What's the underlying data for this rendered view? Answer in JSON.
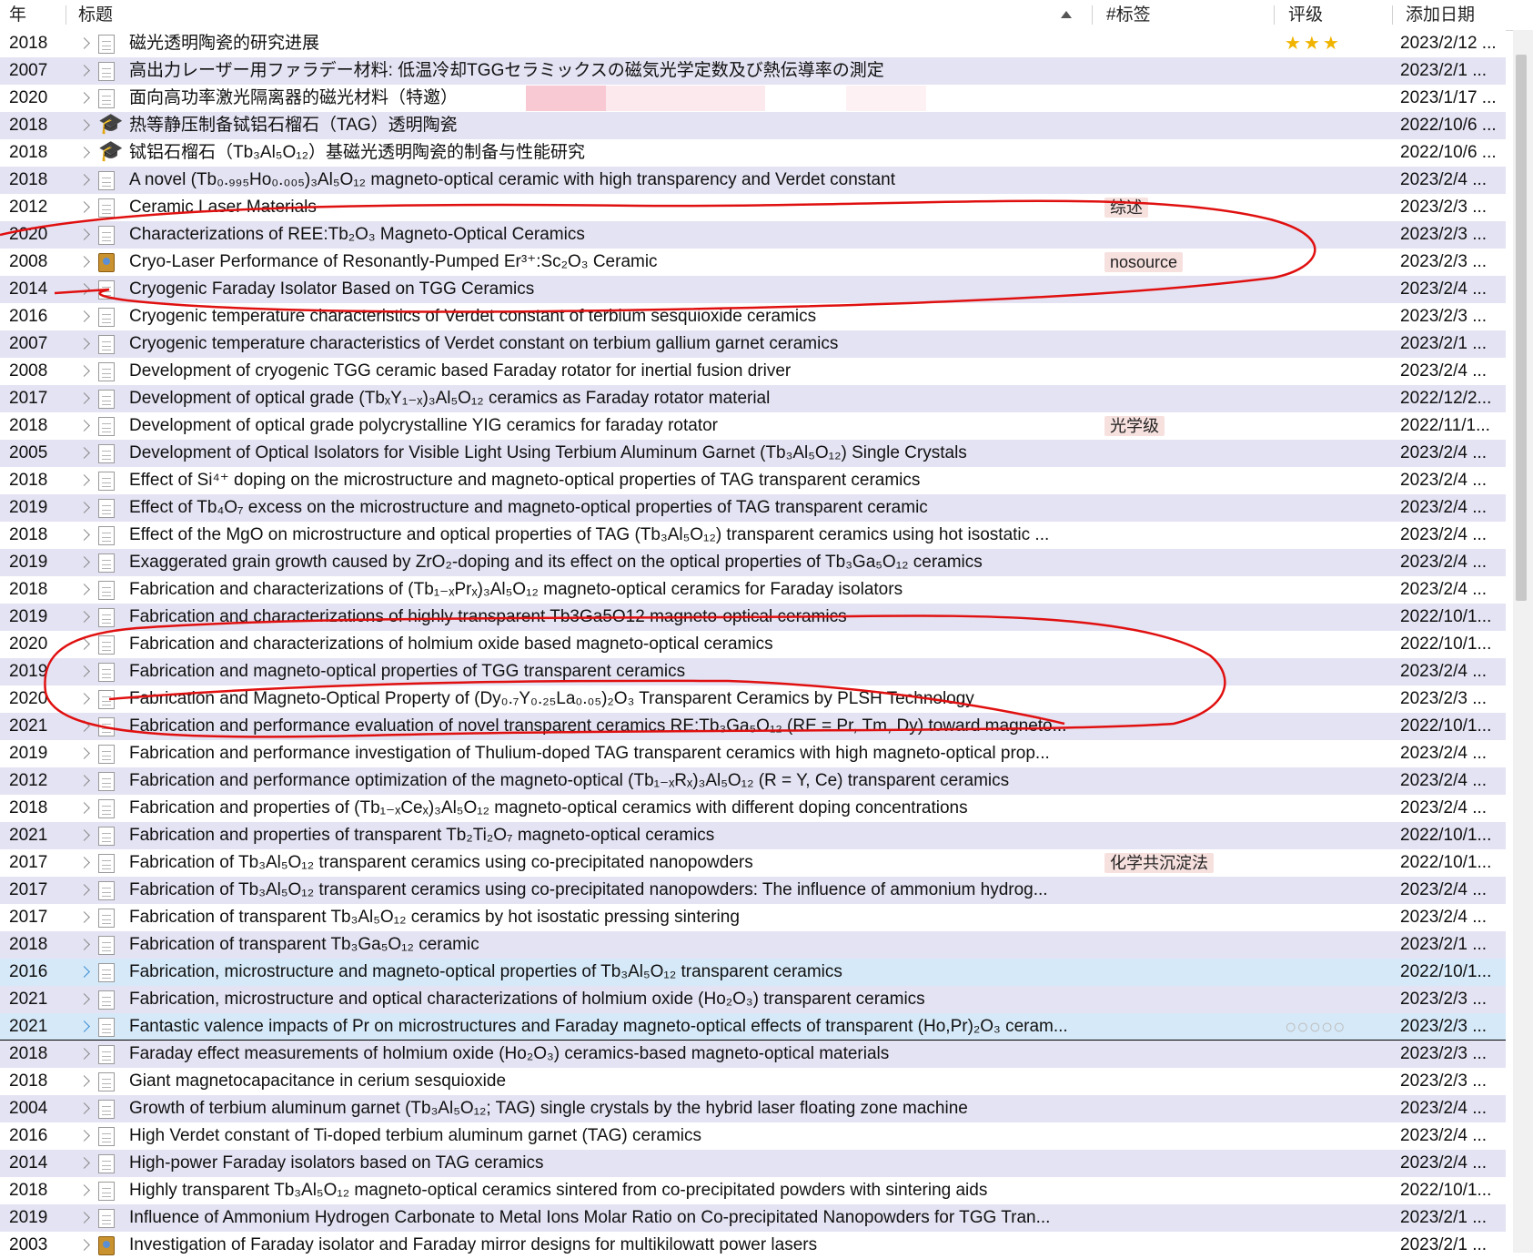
{
  "headers": {
    "year": "年",
    "title": "标题",
    "tags": "#标签",
    "rating": "评级",
    "date_added": "添加日期"
  },
  "rows": [
    {
      "year": "2018",
      "title": "磁光透明陶瓷的研究进展",
      "icon": "doc",
      "tag": "",
      "rating": "★★★",
      "date": "2023/2/12 ..."
    },
    {
      "year": "2007",
      "title": "高出力レーザー用ファラデー材料: 低温冷却TGGセラミックスの磁気光学定数及び熱伝導率の測定",
      "icon": "doc",
      "tag": "",
      "rating": "",
      "date": "2023/2/1 ..."
    },
    {
      "year": "2020",
      "title": "面向高功率激光隔离器的磁光材料（特邀）",
      "icon": "doc",
      "tag": "",
      "rating": "",
      "date": "2023/1/17 ..."
    },
    {
      "year": "2018",
      "title": "热等静压制备铽铝石榴石（TAG）透明陶瓷",
      "icon": "thesis",
      "tag": "",
      "rating": "",
      "date": "2022/10/6 ..."
    },
    {
      "year": "2018",
      "title": "铽铝石榴石（Tb₃Al₅O₁₂）基磁光透明陶瓷的制备与性能研究",
      "icon": "thesis",
      "tag": "",
      "rating": "",
      "date": "2022/10/6 ..."
    },
    {
      "year": "2018",
      "title": "A novel (Tb₀.₉₉₅Ho₀.₀₀₅)₃Al₅O₁₂ magneto-optical ceramic with high transparency and Verdet constant",
      "icon": "doc",
      "tag": "",
      "rating": "",
      "date": "2023/2/4 ..."
    },
    {
      "year": "2012",
      "title": "Ceramic Laser Materials",
      "icon": "doc",
      "tag": "综述",
      "rating": "",
      "date": "2023/2/3 ..."
    },
    {
      "year": "2020",
      "title": "Characterizations of REE:Tb₂O₃ Magneto-Optical Ceramics",
      "icon": "doc",
      "tag": "",
      "rating": "",
      "date": "2023/2/3 ..."
    },
    {
      "year": "2008",
      "title": "Cryo-Laser Performance of Resonantly-Pumped Er³⁺:Sc₂O₃ Ceramic",
      "icon": "book",
      "tag": "nosource",
      "rating": "",
      "date": "2023/2/3 ..."
    },
    {
      "year": "2014",
      "title": "Cryogenic Faraday Isolator Based on TGG Ceramics",
      "icon": "doc",
      "tag": "",
      "rating": "",
      "date": "2023/2/4 ..."
    },
    {
      "year": "2016",
      "title": "Cryogenic temperature characteristics of Verdet constant of terbium sesquioxide ceramics",
      "icon": "doc",
      "tag": "",
      "rating": "",
      "date": "2023/2/3 ..."
    },
    {
      "year": "2007",
      "title": "Cryogenic temperature characteristics of Verdet constant on terbium gallium garnet ceramics",
      "icon": "doc",
      "tag": "",
      "rating": "",
      "date": "2023/2/1 ..."
    },
    {
      "year": "2008",
      "title": "Development of cryogenic TGG ceramic based Faraday rotator for inertial fusion driver",
      "icon": "doc",
      "tag": "",
      "rating": "",
      "date": "2023/2/4 ..."
    },
    {
      "year": "2017",
      "title": "Development of optical grade (TbₓY₁₋ₓ)₃Al₅O₁₂ ceramics as Faraday rotator material",
      "icon": "doc",
      "tag": "",
      "rating": "",
      "date": "2022/12/2..."
    },
    {
      "year": "2018",
      "title": "Development of optical grade polycrystalline YIG ceramics for faraday rotator",
      "icon": "doc",
      "tag": "光学级",
      "rating": "",
      "date": "2022/11/1..."
    },
    {
      "year": "2005",
      "title": "Development of Optical Isolators for Visible Light Using Terbium Aluminum Garnet (Tb₃Al₅O₁₂) Single Crystals",
      "icon": "doc",
      "tag": "",
      "rating": "",
      "date": "2023/2/4 ..."
    },
    {
      "year": "2018",
      "title": "Effect of Si⁴⁺ doping on the microstructure and magneto-optical properties of TAG transparent ceramics",
      "icon": "doc",
      "tag": "",
      "rating": "",
      "date": "2023/2/4 ..."
    },
    {
      "year": "2019",
      "title": "Effect of Tb₄O₇ excess on the microstructure and magneto-optical properties of TAG transparent ceramic",
      "icon": "doc",
      "tag": "",
      "rating": "",
      "date": "2023/2/4 ..."
    },
    {
      "year": "2018",
      "title": "Effect of the MgO on microstructure and optical properties of TAG (Tb₃Al₅O₁₂) transparent ceramics using hot isostatic ...",
      "icon": "doc",
      "tag": "",
      "rating": "",
      "date": "2023/2/4 ..."
    },
    {
      "year": "2019",
      "title": "Exaggerated grain growth caused by ZrO₂-doping and its effect on the optical properties of Tb₃Ga₅O₁₂ ceramics",
      "icon": "doc",
      "tag": "",
      "rating": "",
      "date": "2023/2/4 ..."
    },
    {
      "year": "2018",
      "title": "Fabrication and characterizations of (Tb₁₋ₓPrₓ)₃Al₅O₁₂ magneto-optical ceramics for Faraday isolators",
      "icon": "doc",
      "tag": "",
      "rating": "",
      "date": "2023/2/4 ..."
    },
    {
      "year": "2019",
      "title": "Fabrication and characterizations of highly transparent Tb3Ga5O12 magneto-optical ceramics",
      "icon": "doc",
      "tag": "",
      "rating": "",
      "date": "2022/10/1..."
    },
    {
      "year": "2020",
      "title": "Fabrication and characterizations of holmium oxide based magneto-optical ceramics",
      "icon": "doc",
      "tag": "",
      "rating": "",
      "date": "2022/10/1..."
    },
    {
      "year": "2019",
      "title": "Fabrication and magneto-optical properties of TGG transparent ceramics",
      "icon": "doc",
      "tag": "",
      "rating": "",
      "date": "2023/2/4 ..."
    },
    {
      "year": "2020",
      "title": "Fabrication and Magneto-Optical Property of (Dy₀.₇Y₀.₂₅La₀.₀₅)₂O₃ Transparent Ceramics by PLSH Technology",
      "icon": "doc",
      "tag": "",
      "rating": "",
      "date": "2023/2/3 ..."
    },
    {
      "year": "2021",
      "title": "Fabrication and performance evaluation of novel transparent ceramics RE:Tb₃Ga₅O₁₂ (RE = Pr, Tm, Dy) toward magneto...",
      "icon": "doc",
      "tag": "",
      "rating": "",
      "date": "2022/10/1..."
    },
    {
      "year": "2019",
      "title": "Fabrication and performance investigation of Thulium-doped TAG transparent ceramics with high magneto-optical prop...",
      "icon": "doc",
      "tag": "",
      "rating": "",
      "date": "2023/2/4 ..."
    },
    {
      "year": "2012",
      "title": "Fabrication and performance optimization of the magneto-optical (Tb₁₋ₓRₓ)₃Al₅O₁₂ (R = Y, Ce) transparent ceramics",
      "icon": "doc",
      "tag": "",
      "rating": "",
      "date": "2023/2/4 ..."
    },
    {
      "year": "2018",
      "title": "Fabrication and properties of (Tb₁₋ₓCeₓ)₃Al₅O₁₂ magneto-optical ceramics with different doping concentrations",
      "icon": "doc",
      "tag": "",
      "rating": "",
      "date": "2023/2/4 ..."
    },
    {
      "year": "2021",
      "title": "Fabrication and properties of transparent Tb₂Ti₂O₇ magneto-optical ceramics",
      "icon": "doc",
      "tag": "",
      "rating": "",
      "date": "2022/10/1..."
    },
    {
      "year": "2017",
      "title": "Fabrication of Tb₃Al₅O₁₂ transparent ceramics using co-precipitated nanopowders",
      "icon": "doc",
      "tag": "化学共沉淀法",
      "rating": "",
      "date": "2022/10/1..."
    },
    {
      "year": "2017",
      "title": "Fabrication of Tb₃Al₅O₁₂ transparent ceramics using co-precipitated nanopowders: The influence of ammonium hydrog...",
      "icon": "doc",
      "tag": "",
      "rating": "",
      "date": "2023/2/4 ..."
    },
    {
      "year": "2017",
      "title": "Fabrication of transparent Tb₃Al₅O₁₂ ceramics by hot isostatic pressing sintering",
      "icon": "doc",
      "tag": "",
      "rating": "",
      "date": "2023/2/4 ..."
    },
    {
      "year": "2018",
      "title": "Fabrication of transparent Tb₃Ga₅O₁₂ ceramic",
      "icon": "doc",
      "tag": "",
      "rating": "",
      "date": "2023/2/1 ..."
    },
    {
      "year": "2016",
      "title": "Fabrication, microstructure and magneto-optical properties of Tb₃Al₅O₁₂ transparent ceramics",
      "icon": "doc",
      "tag": "",
      "rating": "",
      "date": "2022/10/1...",
      "selected": true
    },
    {
      "year": "2021",
      "title": "Fabrication, microstructure and optical characterizations of holmium oxide (Ho₂O₃) transparent ceramics",
      "icon": "doc",
      "tag": "",
      "rating": "",
      "date": "2023/2/3 ..."
    },
    {
      "year": "2021",
      "title": "Fantastic valence impacts of Pr on microstructures and Faraday magneto-optical effects of transparent (Ho,Pr)₂O₃ ceram...",
      "icon": "doc",
      "tag": "",
      "rating": "○○○○○",
      "date": "2023/2/3 ...",
      "selected": true,
      "focus": true
    },
    {
      "year": "2018",
      "title": "Faraday effect measurements of holmium oxide (Ho₂O₃) ceramics-based magneto-optical materials",
      "icon": "doc",
      "tag": "",
      "rating": "",
      "date": "2023/2/3 ..."
    },
    {
      "year": "2018",
      "title": "Giant magnetocapacitance in cerium sesquioxide",
      "icon": "doc",
      "tag": "",
      "rating": "",
      "date": "2023/2/3 ..."
    },
    {
      "year": "2004",
      "title": "Growth of terbium aluminum garnet (Tb₃Al₅O₁₂; TAG) single crystals by the hybrid laser floating zone machine",
      "icon": "doc",
      "tag": "",
      "rating": "",
      "date": "2023/2/4 ..."
    },
    {
      "year": "2016",
      "title": "High Verdet constant of Ti-doped terbium aluminum garnet (TAG) ceramics",
      "icon": "doc",
      "tag": "",
      "rating": "",
      "date": "2023/2/4 ..."
    },
    {
      "year": "2014",
      "title": "High-power Faraday isolators based on TAG ceramics",
      "icon": "doc",
      "tag": "",
      "rating": "",
      "date": "2023/2/4 ..."
    },
    {
      "year": "2018",
      "title": "Highly transparent Tb₃Al₅O₁₂ magneto-optical ceramics sintered from co-precipitated powders with sintering aids",
      "icon": "doc",
      "tag": "",
      "rating": "",
      "date": "2022/10/1..."
    },
    {
      "year": "2019",
      "title": "Influence of Ammonium Hydrogen Carbonate to Metal Ions Molar Ratio on Co-precipitated Nanopowders for TGG Tran...",
      "icon": "doc",
      "tag": "",
      "rating": "",
      "date": "2023/2/1 ..."
    },
    {
      "year": "2003",
      "title": "Investigation of Faraday isolator and Faraday mirror designs for multikilowatt power lasers",
      "icon": "book",
      "tag": "",
      "rating": "",
      "date": "2023/2/1 ..."
    }
  ]
}
